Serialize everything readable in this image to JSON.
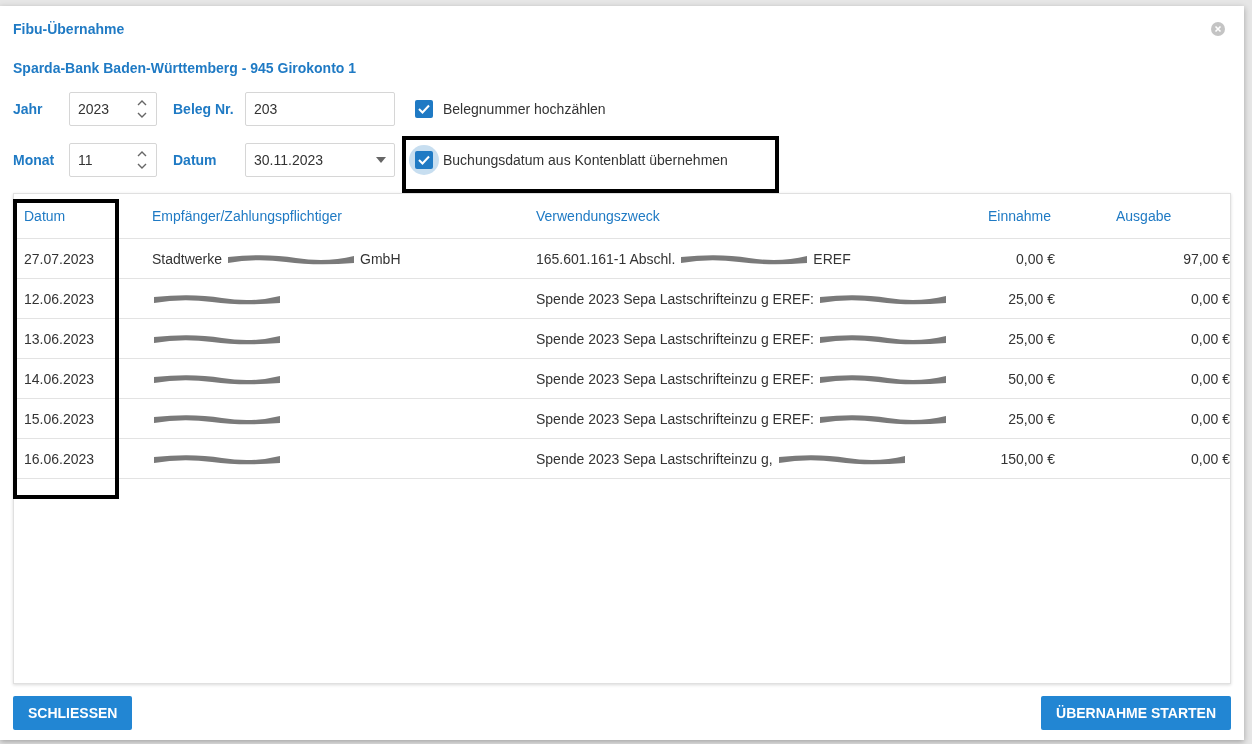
{
  "dialog": {
    "title": "Fibu-Übernahme",
    "account": "Sparda-Bank Baden-Württemberg - 945 Girokonto 1"
  },
  "fields": [
    {
      "label": "Jahr",
      "value": "2023",
      "kind": "spinner"
    },
    {
      "label": "Beleg Nr.",
      "value": "203",
      "kind": "text"
    },
    {
      "label": "Monat",
      "value": "11",
      "kind": "spinner"
    },
    {
      "label": "Datum",
      "value": "30.11.2023",
      "kind": "dropdown"
    }
  ],
  "checkboxes": [
    {
      "label": "Belegnummer hochzählen",
      "checked": true,
      "focused": false
    },
    {
      "label": "Buchungsdatum aus Kontenblatt übernehmen",
      "checked": true,
      "focused": true
    }
  ],
  "table": {
    "columns": [
      "Datum",
      "Empfänger/Zahlungspflichtiger",
      "Verwendungszweck",
      "Einnahme",
      "Ausgabe"
    ],
    "rows": [
      {
        "date": "27.07.2023",
        "payee": [
          {
            "kind": "text",
            "text": "Stadtwerke"
          },
          {
            "kind": "redaction"
          },
          {
            "kind": "text",
            "text": "GmbH"
          }
        ],
        "purpose": [
          {
            "kind": "text",
            "text": "165.601.161-1 Abschl."
          },
          {
            "kind": "redaction"
          },
          {
            "kind": "text",
            "text": "EREF"
          }
        ],
        "income": "0,00 €",
        "expense": "97,00 €"
      },
      {
        "date": "12.06.2023",
        "payee": [
          {
            "kind": "redaction"
          }
        ],
        "purpose": [
          {
            "kind": "text",
            "text": "Spende 2023 Sepa Lastschrifteinzu g EREF:"
          },
          {
            "kind": "redaction"
          }
        ],
        "income": "25,00 €",
        "expense": "0,00 €"
      },
      {
        "date": "13.06.2023",
        "payee": [
          {
            "kind": "redaction"
          }
        ],
        "purpose": [
          {
            "kind": "text",
            "text": "Spende 2023 Sepa Lastschrifteinzu g EREF:"
          },
          {
            "kind": "redaction"
          }
        ],
        "income": "25,00 €",
        "expense": "0,00 €"
      },
      {
        "date": "14.06.2023",
        "payee": [
          {
            "kind": "redaction"
          }
        ],
        "purpose": [
          {
            "kind": "text",
            "text": "Spende 2023 Sepa Lastschrifteinzu g EREF:"
          },
          {
            "kind": "redaction"
          }
        ],
        "income": "50,00 €",
        "expense": "0,00 €"
      },
      {
        "date": "15.06.2023",
        "payee": [
          {
            "kind": "redaction"
          }
        ],
        "purpose": [
          {
            "kind": "text",
            "text": "Spende 2023 Sepa Lastschrifteinzu g EREF:"
          },
          {
            "kind": "redaction"
          }
        ],
        "income": "25,00 €",
        "expense": "0,00 €"
      },
      {
        "date": "16.06.2023",
        "payee": [
          {
            "kind": "redaction"
          }
        ],
        "purpose": [
          {
            "kind": "text",
            "text": "Spende 2023 Sepa Lastschrifteinzu g,"
          },
          {
            "kind": "redaction"
          }
        ],
        "income": "150,00 €",
        "expense": "0,00 €"
      }
    ]
  },
  "buttons": [
    {
      "label": "SCHLIESSEN"
    },
    {
      "label": "ÜBERNAHME STARTEN"
    }
  ]
}
